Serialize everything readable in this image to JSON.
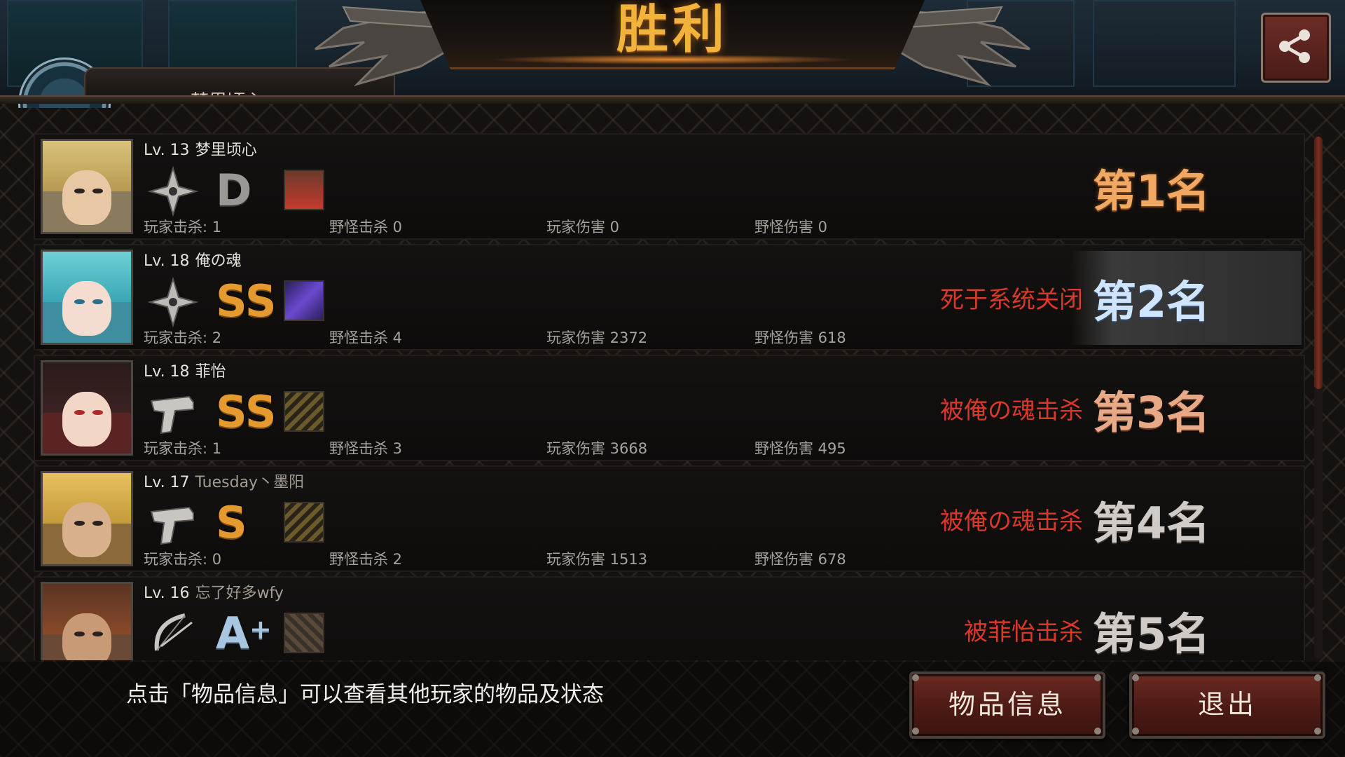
{
  "header": {
    "title": "胜利",
    "player_tab_name": "梦里顷心"
  },
  "share_icon": "share-icon",
  "players": [
    {
      "level": "Lv. 13",
      "name": "梦里顷心",
      "weapon_icon": "shuriken-icon",
      "grade": "D",
      "item_icon": "character-item-icon",
      "stats": {
        "player_kills": "玩家击杀: 1",
        "monster_kills": "野怪击杀 0",
        "player_damage": "玩家伤害 0",
        "monster_damage": "野怪伤害 0"
      },
      "death": "",
      "rank": "第1名"
    },
    {
      "level": "Lv. 18",
      "name": "俺の魂",
      "weapon_icon": "shuriken-icon",
      "grade": "SS",
      "item_icon": "purple-item-icon",
      "stats": {
        "player_kills": "玩家击杀: 2",
        "monster_kills": "野怪击杀 4",
        "player_damage": "玩家伤害 2372",
        "monster_damage": "野怪伤害 618"
      },
      "death": "死于系统关闭",
      "rank": "第2名"
    },
    {
      "level": "Lv. 18",
      "name": "菲怡",
      "weapon_icon": "pistol-icon",
      "grade": "SS",
      "item_icon": "ammo-icon",
      "stats": {
        "player_kills": "玩家击杀: 1",
        "monster_kills": "野怪击杀 3",
        "player_damage": "玩家伤害 3668",
        "monster_damage": "野怪伤害 495"
      },
      "death": "被俺の魂击杀",
      "rank": "第3名"
    },
    {
      "level": "Lv. 17",
      "name": "Tuesday丶墨阳",
      "weapon_icon": "pistol-icon",
      "grade": "S",
      "item_icon": "ammo-icon",
      "stats": {
        "player_kills": "玩家击杀: 0",
        "monster_kills": "野怪击杀 2",
        "player_damage": "玩家伤害 1513",
        "monster_damage": "野怪伤害 678"
      },
      "death": "被俺の魂击杀",
      "rank": "第4名"
    },
    {
      "level": "Lv. 16",
      "name": "忘了好多wfy",
      "weapon_icon": "bow-icon",
      "grade": "A",
      "grade_plus": "+",
      "item_icon": "bolts-icon",
      "stats": {
        "player_kills": "",
        "monster_kills": "",
        "player_damage": "",
        "monster_damage": ""
      },
      "death": "被菲怡击杀",
      "rank": "第5名"
    }
  ],
  "footer": {
    "hint": "点击「物品信息」可以查看其他玩家的物品及状态",
    "items_button": "物品信息",
    "exit_button": "退出"
  },
  "colors": {
    "title": "#f2b33c",
    "death_text": "#d9382a",
    "button_red": "#5a2019",
    "grade_gold": "#e49a2e"
  }
}
